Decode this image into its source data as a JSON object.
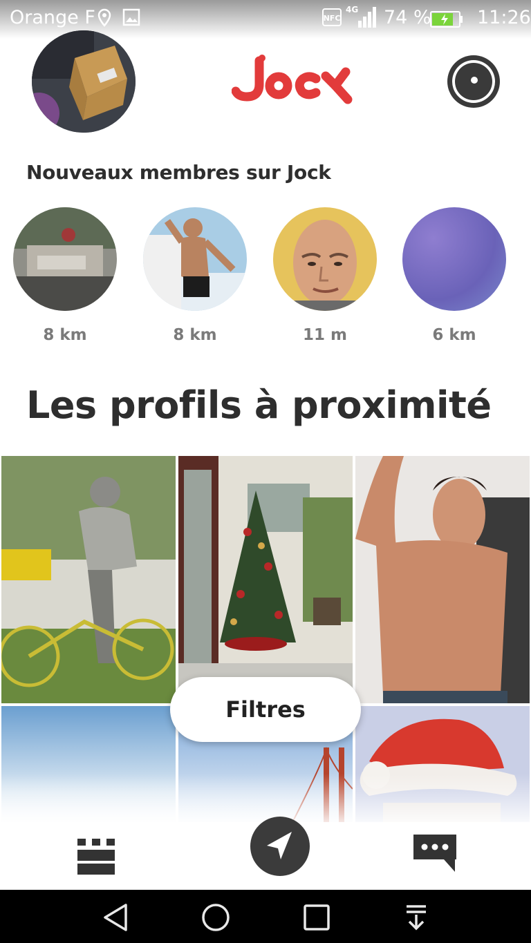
{
  "status_bar": {
    "carrier": "Orange F",
    "battery": "74 %",
    "time": "11:26",
    "icons": [
      "location-icon",
      "image-icon",
      "nfc-icon",
      "4g-signal-icon",
      "battery-charging-icon"
    ]
  },
  "header": {
    "logo_text": "Jock",
    "brand_color": "#e23b3b",
    "icons": [
      "camera-icon"
    ]
  },
  "new_members": {
    "title": "Nouveaux membres sur Jock",
    "members": [
      {
        "distance": "8 km"
      },
      {
        "distance": "8 km"
      },
      {
        "distance": "11  m"
      },
      {
        "distance": "6 km"
      }
    ]
  },
  "nearby": {
    "title": "Les profils à proximité",
    "filters_label": "Filtres"
  },
  "tabbar": {
    "icons": [
      "grid-icon",
      "navigation-arrow-icon",
      "chat-bubble-icon"
    ]
  },
  "system_nav": {
    "icons": [
      "back-icon",
      "home-icon",
      "recents-icon",
      "notification-pull-icon"
    ]
  }
}
